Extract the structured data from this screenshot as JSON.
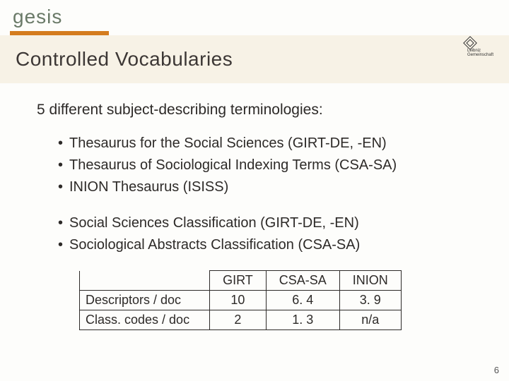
{
  "brand": {
    "logo_text": "gesis"
  },
  "partner_logo": {
    "line1": "Leibniz",
    "line2": "Gemeinschaft"
  },
  "title": "Controlled Vocabularies",
  "intro": "5 different subject-describing terminologies:",
  "bullets_a": [
    "Thesaurus for the Social Sciences (GIRT-DE, -EN)",
    "Thesaurus of Sociological Indexing Terms (CSA-SA)",
    "INION Thesaurus (ISISS)"
  ],
  "bullets_b": [
    "Social Sciences Classification (GIRT-DE, -EN)",
    "Sociological Abstracts Classification (CSA-SA)"
  ],
  "chart_data": {
    "type": "table",
    "columns": [
      "GIRT",
      "CSA-SA",
      "INION"
    ],
    "rows": [
      {
        "label": "Descriptors / doc",
        "values": [
          "10",
          "6. 4",
          "3. 9"
        ]
      },
      {
        "label": "Class. codes / doc",
        "values": [
          "2",
          "1. 3",
          "n/a"
        ]
      }
    ]
  },
  "page_number": "6"
}
